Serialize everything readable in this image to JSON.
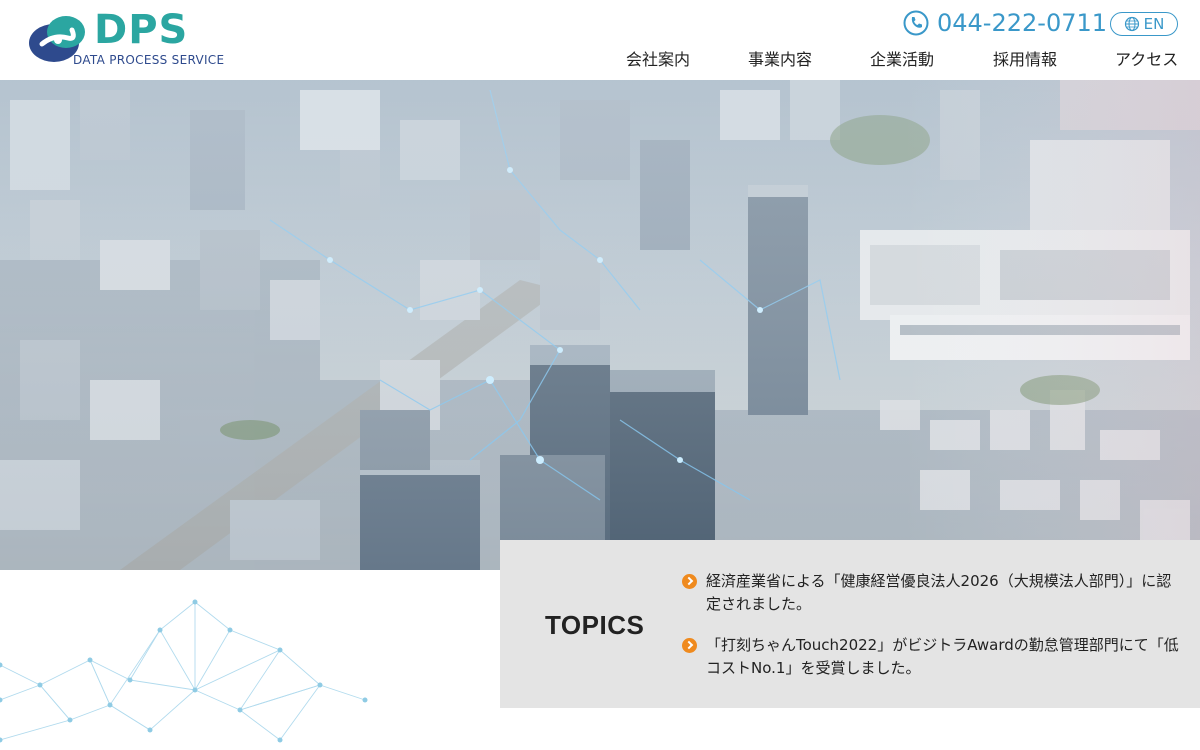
{
  "brand": {
    "name": "DPS",
    "tagline": "DATA PROCESS SERVICE",
    "colors": {
      "teal": "#2ba6a1",
      "navy": "#2e4a8d",
      "accent_blue": "#3a98c9",
      "orange": "#ef8a1e"
    }
  },
  "header": {
    "phone_icon": "phone-icon",
    "phone": "044-222-0711",
    "lang_icon": "globe-icon",
    "lang": "EN"
  },
  "nav": {
    "items": [
      {
        "label": "会社案内"
      },
      {
        "label": "事業内容"
      },
      {
        "label": "企業活動"
      },
      {
        "label": "採用情報"
      },
      {
        "label": "アクセス"
      }
    ]
  },
  "topics": {
    "title": "TOPICS",
    "items": [
      {
        "text": "経済産業省による「健康経営優良法人2026（大規模法人部門）」に認定されました。"
      },
      {
        "text": "「打刻ちゃんTouch2022」がビジトラAwardの勤怠管理部門にて「低コストNo.1」を受賞しました。"
      }
    ]
  }
}
